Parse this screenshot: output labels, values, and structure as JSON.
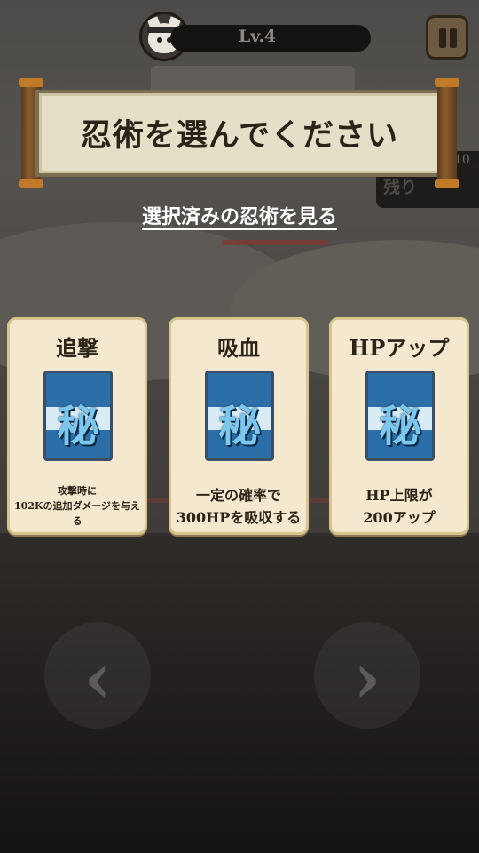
{
  "hud": {
    "level": "Lv.4",
    "remaining_label": "残り",
    "remaining_count": "10"
  },
  "banner": {
    "title": "忍術を選んでください"
  },
  "selected_link": "選択済みの忍術を見る",
  "cards": [
    {
      "name": "追撃",
      "icon_glyph": "秘",
      "desc_lines": [
        "攻撃時に",
        "102Kの追加ダメージを与え",
        "る"
      ]
    },
    {
      "name": "吸血",
      "icon_glyph": "秘",
      "desc_lines": [
        "一定の確率で",
        "300HPを吸収する"
      ]
    },
    {
      "name": "HPアップ",
      "icon_glyph": "秘",
      "desc_lines": [
        "HP上限が",
        "200アップ"
      ]
    }
  ],
  "nav": {
    "prev_glyph": "‹",
    "next_glyph": "›"
  },
  "colors": {
    "card_bg": "#f4e9cf",
    "scroll_bg": "#e6dfc8",
    "icon_blue": "#2c6ea8"
  }
}
